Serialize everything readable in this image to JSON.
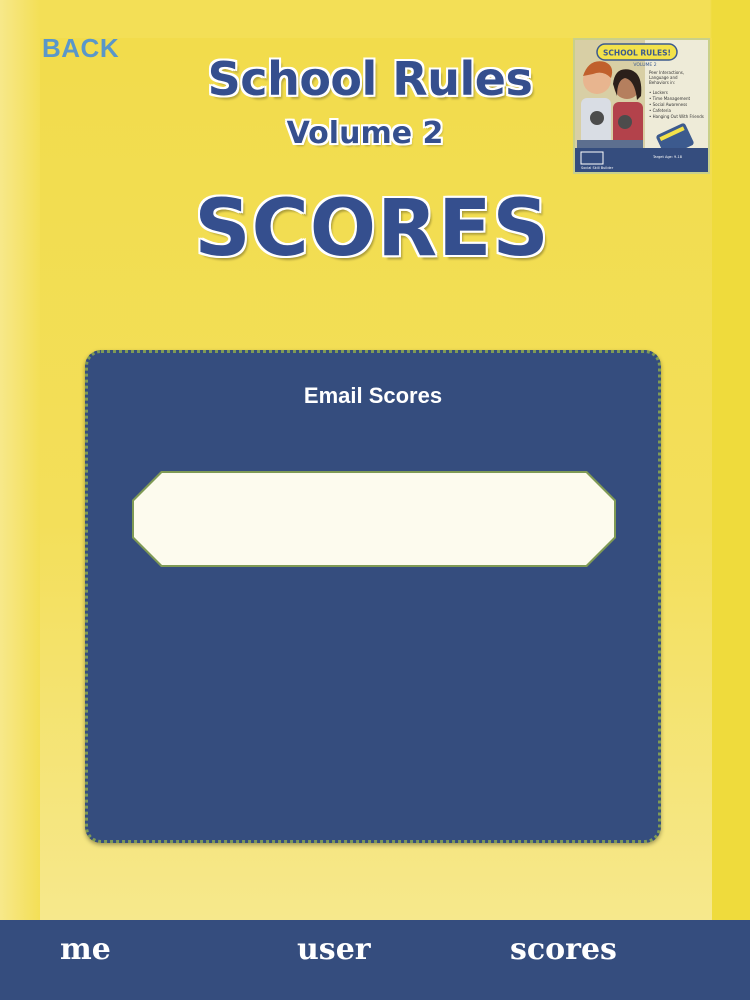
{
  "header": {
    "back_label": "BACK",
    "title": "School Rules",
    "subtitle": "Volume 2",
    "heading": "SCORES"
  },
  "cover": {
    "title": "SCHOOL RULES!",
    "volume": "VOLUME 2",
    "blurb": "Peer Interactions, Language and Behaviors in:",
    "bullets": [
      "Lockers",
      "Time Management",
      "Social Awareness",
      "Cafeteria",
      "Hanging Out With Friends"
    ],
    "target_age": "Target Age: 9-18",
    "publisher": "Social Skill Builder"
  },
  "score_panel": {
    "title": "Email Scores",
    "email_value": "",
    "email_placeholder": ""
  },
  "tabs": [
    {
      "label": "me"
    },
    {
      "label": "user"
    },
    {
      "label": "scores"
    }
  ],
  "colors": {
    "background_yellow": "#f3df56",
    "navy": "#354d7e",
    "title_blue": "#354f8e",
    "back_blue": "#5a97c9",
    "field_cream": "#fdfbee",
    "border_green": "#7f9a55"
  }
}
